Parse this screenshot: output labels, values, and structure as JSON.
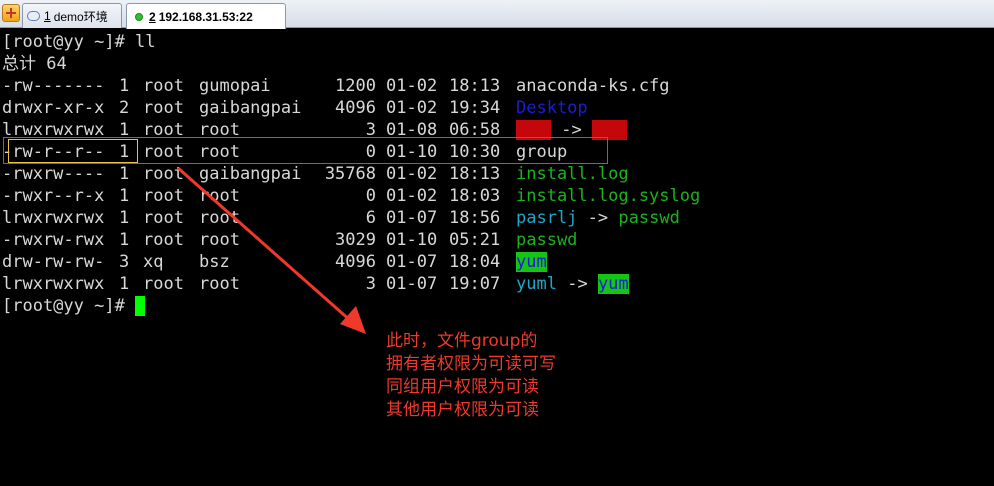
{
  "tabs": [
    {
      "number": "1",
      "label": "demo环境",
      "active": false
    },
    {
      "number": "2",
      "label": "192.168.31.53:22",
      "active": true
    }
  ],
  "terminal": {
    "prompt_cmd": "[root@yy ~]# ll",
    "total": "总计 64",
    "rows": [
      {
        "perm": "-rw-------",
        "links": "1",
        "owner": "root",
        "group": "gumopai",
        "size": "1200",
        "date": "01-02",
        "time": "18:13",
        "name": "anaconda-ks.cfg",
        "target": ""
      },
      {
        "perm": "drwxr-xr-x",
        "links": "2",
        "owner": "root",
        "group": "gaibangpai",
        "size": "4096",
        "date": "01-02",
        "time": "19:34",
        "name": "Desktop",
        "target": ""
      },
      {
        "perm": "lrwxrwxrwx",
        "links": "1",
        "owner": "root",
        "group": "root",
        "size": "3",
        "date": "01-08",
        "time": "06:58",
        "name": "",
        "target": ""
      },
      {
        "perm": "-rw-r--r--",
        "links": "1",
        "owner": "root",
        "group": "root",
        "size": "0",
        "date": "01-10",
        "time": "10:30",
        "name": "group",
        "target": ""
      },
      {
        "perm": "-rwxrw----",
        "links": "1",
        "owner": "root",
        "group": "gaibangpai",
        "size": "35768",
        "date": "01-02",
        "time": "18:13",
        "name": "install.log",
        "target": ""
      },
      {
        "perm": "-rwxr--r-x",
        "links": "1",
        "owner": "root",
        "group": "root",
        "size": "0",
        "date": "01-02",
        "time": "18:03",
        "name": "install.log.syslog",
        "target": ""
      },
      {
        "perm": "lrwxrwxrwx",
        "links": "1",
        "owner": "root",
        "group": "root",
        "size": "6",
        "date": "01-07",
        "time": "18:56",
        "name": "pasrlj",
        "target": "passwd"
      },
      {
        "perm": "-rwxrw-rwx",
        "links": "1",
        "owner": "root",
        "group": "root",
        "size": "3029",
        "date": "01-10",
        "time": "05:21",
        "name": "passwd",
        "target": ""
      },
      {
        "perm": "drw-rw-rw-",
        "links": "3",
        "owner": "xq",
        "group": "bsz",
        "size": "4096",
        "date": "01-07",
        "time": "18:04",
        "name": "yum",
        "target": ""
      },
      {
        "perm": "lrwxrwxrwx",
        "links": "1",
        "owner": "root",
        "group": "root",
        "size": "3",
        "date": "01-07",
        "time": "19:07",
        "name": "yuml",
        "target": "yum"
      }
    ],
    "arrow_symbol": "->",
    "final_prompt": "[root@yy ~]#"
  },
  "annotation": {
    "lines": [
      "此时，文件group的",
      "拥有者权限为可读可写",
      "同组用户权限为可读",
      "其他用户权限为可读"
    ],
    "color": "#f0382b"
  }
}
